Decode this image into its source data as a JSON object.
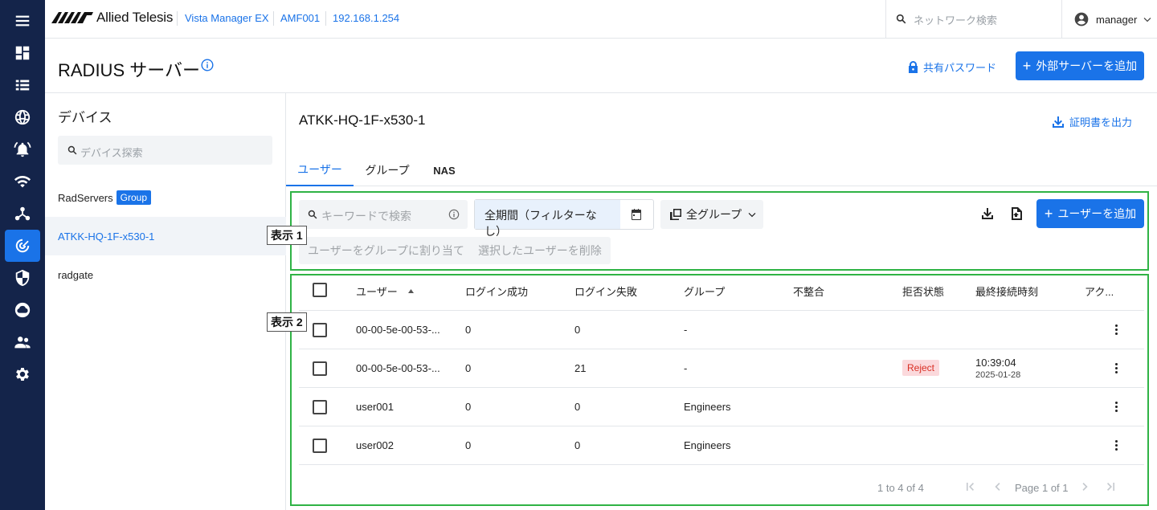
{
  "topbar": {
    "brand": "Allied Telesis",
    "product": "Vista Manager EX",
    "device": "AMF001",
    "ip": "192.168.1.254",
    "search_placeholder": "ネットワーク検索",
    "username": "manager"
  },
  "header": {
    "title": "RADIUS サーバー",
    "shared_password": "共有パスワード",
    "add_server": "外部サーバーを追加"
  },
  "devices": {
    "title": "デバイス",
    "search_placeholder": "デバイス探索",
    "items": [
      {
        "name": "RadServers",
        "tag": "Group"
      },
      {
        "name": "ATKK-HQ-1F-x530-1",
        "tag": ""
      },
      {
        "name": "radgate",
        "tag": ""
      }
    ]
  },
  "main": {
    "device_title": "ATKK-HQ-1F-x530-1",
    "export_cert": "証明書を出力",
    "tabs": [
      "ユーザー",
      "グループ",
      "NAS"
    ]
  },
  "toolbar": {
    "keyword_placeholder": "キーワードで検索",
    "period": "全期間（フィルターなし）",
    "group_filter": "全グループ",
    "add_user": "ユーザーを追加",
    "assign_group": "ユーザーをグループに割り当て",
    "delete_selected": "選択したユーザーを削除"
  },
  "labels": {
    "area1": "表示 1",
    "area2": "表示 2"
  },
  "table": {
    "columns": [
      "ユーザー",
      "ログイン成功",
      "ログイン失敗",
      "グループ",
      "不整合",
      "拒否状態",
      "最終接続時刻",
      "アク..."
    ],
    "rows": [
      {
        "user": "00-00-5e-00-53-...",
        "success": "0",
        "fail": "0",
        "group": "-",
        "mismatch": "",
        "reject": "",
        "time": "",
        "date": ""
      },
      {
        "user": "00-00-5e-00-53-...",
        "success": "0",
        "fail": "21",
        "group": "-",
        "mismatch": "",
        "reject": "Reject",
        "time": "10:39:04",
        "date": "2025-01-28"
      },
      {
        "user": "user001",
        "success": "0",
        "fail": "0",
        "group": "Engineers",
        "mismatch": "",
        "reject": "",
        "time": "",
        "date": ""
      },
      {
        "user": "user002",
        "success": "0",
        "fail": "0",
        "group": "Engineers",
        "mismatch": "",
        "reject": "",
        "time": "",
        "date": ""
      }
    ]
  },
  "pagination": {
    "range": "1 to 4 of 4",
    "page": "Page 1 of 1"
  },
  "colors": {
    "accent": "#1a73e8",
    "rail": "#14244a",
    "highlight_box": "#2fb345",
    "reject_bg": "#fbd9dc",
    "reject_text": "#d93025"
  }
}
